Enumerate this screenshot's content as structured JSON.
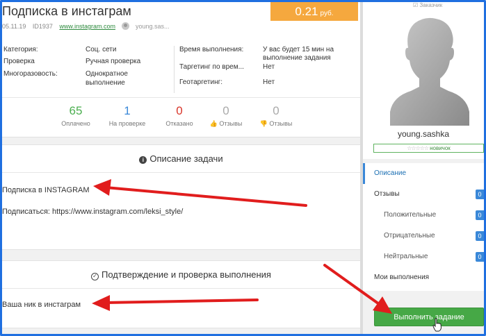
{
  "task": {
    "title": "Подписка в инстаграм",
    "price": "0.21",
    "currency": "руб.",
    "date": "05.11.19",
    "id": "ID1937",
    "link": "www.instagram.com",
    "user_short": "young.sas..."
  },
  "info_left": [
    {
      "label": "Категория:",
      "value": "Соц. сети"
    },
    {
      "label": "Проверка",
      "value": "Ручная проверка"
    },
    {
      "label": "Многоразовость:",
      "value_line1": "Однократное",
      "value_line2": "выполнение"
    }
  ],
  "info_right": [
    {
      "label": "Время выполнения:",
      "value_line1": "У вас будет 15 мин на",
      "value_line2": "выполнение задания"
    },
    {
      "label": "Таргетинг по врем...",
      "value": "Нет"
    },
    {
      "label": "Геотаргетинг:",
      "value": "Нет"
    }
  ],
  "stats": [
    {
      "value": "65",
      "label": "Оплачено",
      "color": "#4caf50"
    },
    {
      "value": "1",
      "label": "На проверке",
      "color": "#3a88d8"
    },
    {
      "value": "0",
      "label": "Отказано",
      "color": "#d9362b"
    },
    {
      "value": "0",
      "label": "Отзывы",
      "color": "#aaaaaa"
    },
    {
      "value": "0",
      "label": "Отзывы",
      "color": "#aaaaaa"
    }
  ],
  "description": {
    "heading": "Описание задачи",
    "line1": "Подписка в INSTAGRAM",
    "line2": "Подписаться: https://www.instagram.com/leksi_style/"
  },
  "confirmation": {
    "heading": "Подтверждение и проверка выполнения",
    "line1": "Ваша ник в инстаграм"
  },
  "sidebar": {
    "customer_tag": "Заказчик",
    "username": "young.sashka",
    "rank": "новичок",
    "menu": {
      "description": "Описание",
      "reviews": "Отзывы",
      "positive": "Положительные",
      "negative": "Отрицательные",
      "neutral": "Нейтральные",
      "my_completions": "Мои выполнения"
    },
    "badges": {
      "reviews": "0",
      "positive": "0",
      "negative": "0",
      "neutral": "0"
    },
    "action_button": "Выполнить задание"
  },
  "colors": {
    "frame": "#1f6fe0",
    "price_bg": "#f5a83e",
    "button_bg": "#46a846",
    "arrow": "#e11d1d",
    "accent": "#3a88d8"
  }
}
